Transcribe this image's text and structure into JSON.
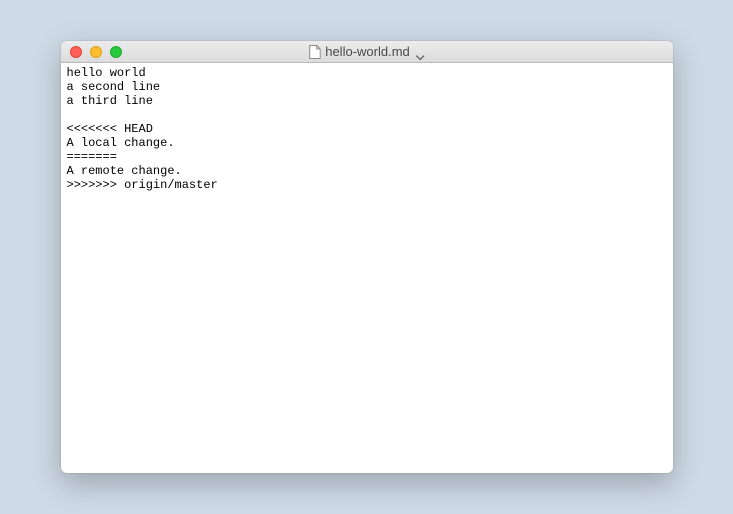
{
  "window": {
    "title": "hello-world.md"
  },
  "editor": {
    "lines": [
      "hello world",
      "a second line",
      "a third line",
      "",
      "<<<<<<< HEAD",
      "A local change.",
      "=======",
      "A remote change.",
      ">>>>>>> origin/master"
    ]
  }
}
